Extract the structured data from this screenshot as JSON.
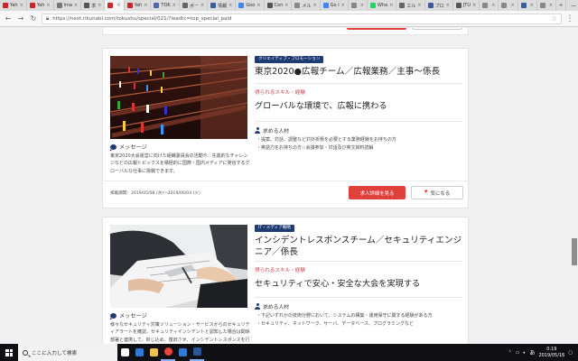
{
  "browser": {
    "tabs": [
      {
        "label": "Yah",
        "color": "#c9252b",
        "active": false
      },
      {
        "label": "Yah",
        "color": "#c9252b",
        "active": false
      },
      {
        "label": "ima",
        "color": "#777777",
        "active": false
      },
      {
        "label": "求",
        "color": "#555555",
        "active": false
      },
      {
        "label": "",
        "color": "#cc2b2b",
        "active": true
      },
      {
        "label": "Yah",
        "color": "#c9252b",
        "active": false
      },
      {
        "label": "TOK",
        "color": "#4a6bb0",
        "active": false
      },
      {
        "label": "ボー",
        "color": "#666666",
        "active": false
      },
      {
        "label": "情報",
        "color": "#3a5ba0",
        "active": false
      },
      {
        "label": "Goo",
        "color": "#4285f4",
        "active": false
      },
      {
        "label": "Con",
        "color": "#555555",
        "active": false
      },
      {
        "label": "メル",
        "color": "#888888",
        "active": false
      },
      {
        "label": "Go i",
        "color": "#4285f4",
        "active": false
      },
      {
        "label": "",
        "color": "#888888",
        "active": false
      },
      {
        "label": "Wha",
        "color": "#25d366",
        "active": false
      },
      {
        "label": "エル",
        "color": "#666666",
        "active": false
      },
      {
        "label": "プロ",
        "color": "#3a5ba0",
        "active": false
      },
      {
        "label": "JTU",
        "color": "#555555",
        "active": false
      },
      {
        "label": "",
        "color": "#888888",
        "active": false
      },
      {
        "label": "",
        "color": "#888888",
        "active": false
      },
      {
        "label": "",
        "color": "#3a5ba0",
        "active": false
      },
      {
        "label": "",
        "color": "#888888",
        "active": false
      }
    ],
    "url": "https://next.rikunabi.com/tokushu/special/021/?leadtc=top_special_paid",
    "window_controls": {
      "minimize": "—",
      "maximize": "□",
      "close": "✕"
    }
  },
  "jobs": [
    {
      "category": "クリエイティブ・プロモーション",
      "title": "東京2020●広報チーム／広報業務／主事〜係長",
      "skill_label": "得られるスキル・経験",
      "headline": "グローバルな環境で、広報に携わる",
      "req_label": "求める人材",
      "requirements": [
        "提案、対話、調整など対外折衝を必要とする業務経験をお持ちの方",
        "英語力をお持ちの方☆会議参加・対話及び英文資料読解"
      ],
      "message_label": "メッセージ",
      "message": "東京2020大会運営に向けた組織委員会の活動や、先進的なチャレンジなどの広報トピックスを積極的に国際・国内メディアに発信するグローバルな仕事に挑戦できます。",
      "period": "掲載期間：2019/05/08 (水)〜2019/06/04 (火)",
      "apply_label": "求人詳細を見る",
      "fav_label": "気になる"
    },
    {
      "category": "IT・メディア戦略",
      "title": "インシデントレスポンスチーム／セキュリティエンジニア／係長",
      "skill_label": "得られるスキル・経験",
      "headline": "セキュリティで安心・安全な大会を実現する",
      "req_label": "求める人材",
      "requirements": [
        "下記いずれかの技術分野において、システムの構築・運用保守に関する経験がある方",
        "セキュリティ、ネットワーク、サーバ、データベース、プログラミングなど"
      ],
      "message_label": "メッセージ",
      "message": "様々なセキュリティ対策ソリューション・サービスからのセキュリティアラートを確認、セキュリティインシデントと認知した場合は関係部署と連携して、封じ込め、復旧させ、インシデントレスポンスを行って頂きます。"
    }
  ],
  "page_top_label": "︿",
  "taskbar": {
    "search_placeholder": "ここに入力して検索",
    "apps": [
      {
        "name": "task-view",
        "color": "#ffffff"
      },
      {
        "name": "edge",
        "color": "#2f7bd8"
      },
      {
        "name": "explorer",
        "color": "#f2c14e"
      },
      {
        "name": "chrome",
        "color": "#e8453c"
      },
      {
        "name": "mail",
        "color": "#2f7bd8"
      },
      {
        "name": "word",
        "color": "#2b579a"
      }
    ],
    "ime": "あ",
    "time": "0:19",
    "date": "2019/05/16"
  }
}
